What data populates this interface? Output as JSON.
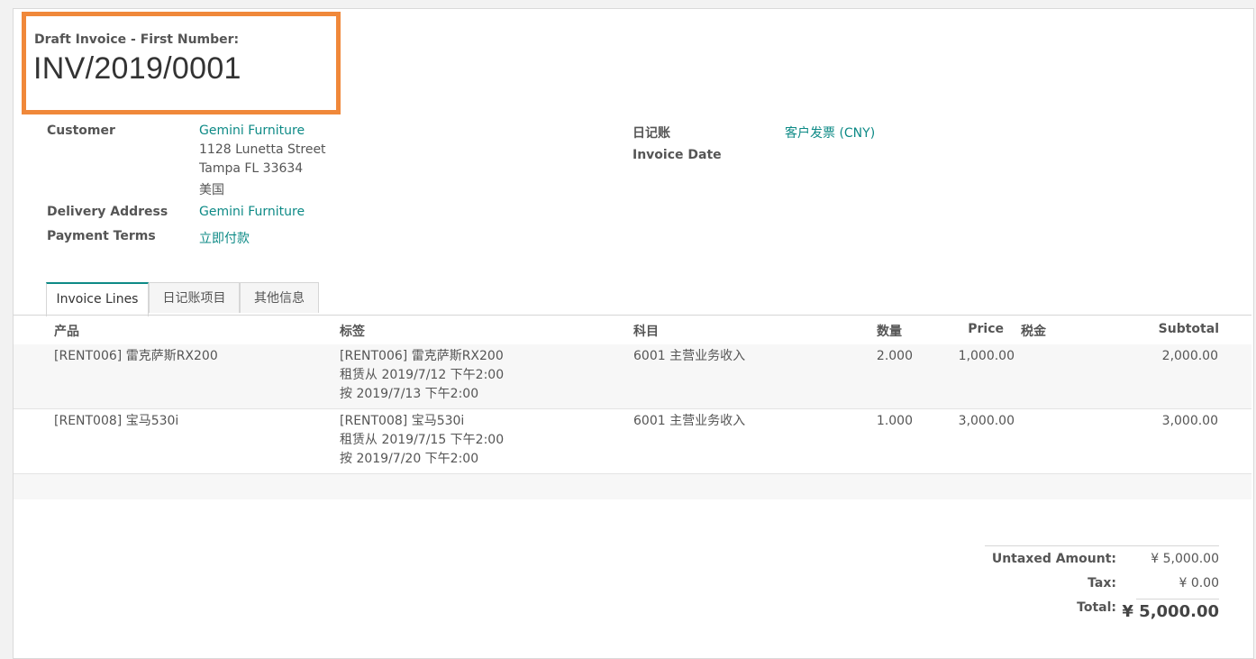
{
  "header": {
    "title_label": "Draft Invoice  - First Number:",
    "invoice_number": "INV/2019/0001"
  },
  "form": {
    "customer_label": "Customer",
    "customer_name": "Gemini Furniture",
    "address_line1": "1128 Lunetta Street",
    "address_line2": "Tampa FL 33634",
    "address_country": "美国",
    "delivery_label": "Delivery Address",
    "delivery_value": "Gemini Furniture",
    "terms_label": "Payment Terms",
    "terms_value": "立即付款",
    "journal_label": "日记账",
    "journal_value": "客户发票 (CNY)",
    "date_label": "Invoice Date"
  },
  "tabs": [
    {
      "label": "Invoice Lines",
      "active": true
    },
    {
      "label": "日记账项目",
      "active": false
    },
    {
      "label": "其他信息",
      "active": false
    }
  ],
  "table": {
    "headers": {
      "product": "产品",
      "label": "标签",
      "account": "科目",
      "quantity": "数量",
      "price": "Price",
      "tax": "税金",
      "subtotal": "Subtotal"
    },
    "rows": [
      {
        "product": "[RENT006] 雷克萨斯RX200",
        "label_line1": "[RENT006] 雷克萨斯RX200",
        "label_line2": "租赁从 2019/7/12 下午2:00",
        "label_line3": "按 2019/7/13 下午2:00",
        "account": "6001 主营业务收入",
        "quantity": "2.000",
        "price": "1,000.00",
        "subtotal": "2,000.00"
      },
      {
        "product": "[RENT008] 宝马530i",
        "label_line1": "[RENT008] 宝马530i",
        "label_line2": "租赁从 2019/7/15 下午2:00",
        "label_line3": "按 2019/7/20 下午2:00",
        "account": "6001 主营业务收入",
        "quantity": "1.000",
        "price": "3,000.00",
        "subtotal": "3,000.00"
      }
    ]
  },
  "totals": {
    "untaxed_label": "Untaxed Amount:",
    "untaxed_value": "¥ 5,000.00",
    "tax_label": "Tax:",
    "tax_value": "¥ 0.00",
    "total_label": "Total:",
    "total_value": "¥ 5,000.00"
  },
  "colors": {
    "accent": "#0d8a86",
    "highlight_box": "#f0883a"
  }
}
